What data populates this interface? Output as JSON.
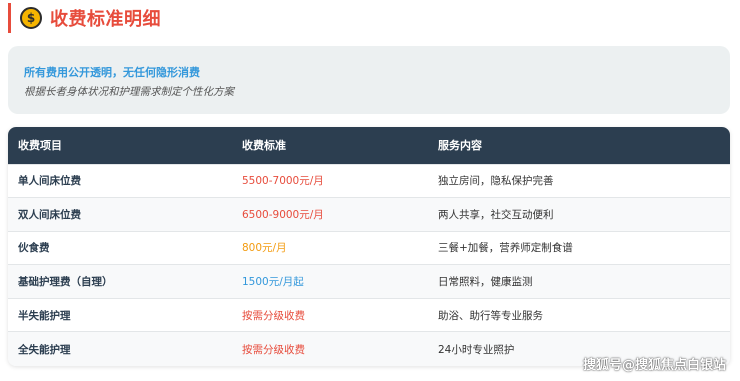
{
  "header": {
    "icon": "money-bag-icon",
    "icon_glyph": "$",
    "title": "收费标准明细"
  },
  "notice": {
    "line1": "所有费用公开透明，无任何隐形消费",
    "line2": "根据长者身体状况和护理需求制定个性化方案"
  },
  "table": {
    "columns": [
      "收费项目",
      "收费标准",
      "服务内容"
    ],
    "rows": [
      {
        "item": "单人间床位费",
        "price": "5500-7000元/月",
        "price_color": "#e74c3c",
        "service": "独立房间，隐私保护完善"
      },
      {
        "item": "双人间床位费",
        "price": "6500-9000元/月",
        "price_color": "#e74c3c",
        "service": "两人共享，社交互动便利"
      },
      {
        "item": "伙食费",
        "price": "800元/月",
        "price_color": "#f39c12",
        "service": "三餐+加餐，营养师定制食谱"
      },
      {
        "item": "基础护理费（自理）",
        "price": "1500元/月起",
        "price_color": "#3498db",
        "service": "日常照料，健康监测"
      },
      {
        "item": "半失能护理",
        "price": "按需分级收费",
        "price_color": "#e74c3c",
        "service": "助浴、助行等专业服务"
      },
      {
        "item": "全失能护理",
        "price": "按需分级收费",
        "price_color": "#e74c3c",
        "service": "24小时专业照护"
      }
    ]
  },
  "watermark": "搜狐号@搜狐焦点白银站",
  "colors": {
    "accent": "#e74c3c",
    "header_bg": "#2c3e50",
    "notice_bg": "#ecf0f1",
    "link_blue": "#3498db"
  }
}
